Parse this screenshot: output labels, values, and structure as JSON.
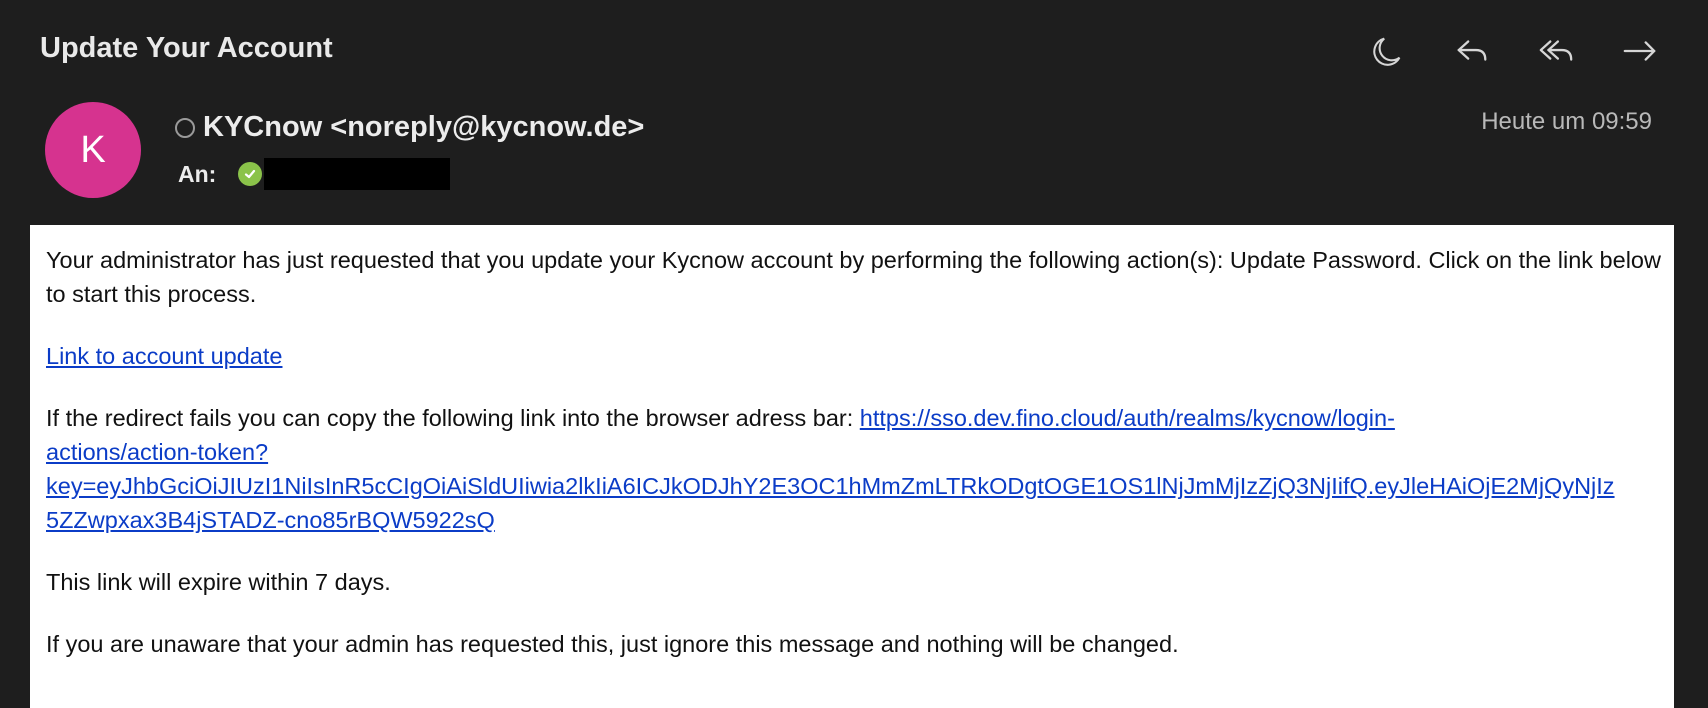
{
  "email": {
    "subject": "Update Your Account",
    "sender": {
      "avatar_initial": "K",
      "avatar_color": "#d6338f",
      "display": "KYCnow <noreply@kycnow.de>"
    },
    "recipient": {
      "label": "An:"
    },
    "timestamp": "Heute um 09:59"
  },
  "toolbar": {
    "icons": [
      "moon-icon",
      "reply-icon",
      "reply-all-icon",
      "forward-icon"
    ]
  },
  "body": {
    "para1": "Your administrator has just requested that you update your Kycnow account by performing the following action(s): Update Password. Click on the link below to start this process.",
    "link_text": "Link to account update",
    "para3_prefix": "If the redirect fails you can copy the following link into the browser adress bar: ",
    "url_line1": "https://sso.dev.fino.cloud/auth/realms/kycnow/login-",
    "url_line2": "actions/action-token?",
    "url_line3": "key=eyJhbGciOiJIUzI1NiIsInR5cCIgOiAiSldUIiwia2lkIiA6ICJkODJhY2E3OC1hMmZmLTRkODgtOGE1OS1lNjJmMjIzZjQ3NjIifQ.eyJleHAiOjE2MjQyNjIz",
    "url_line4": "5ZZwpxax3B4jSTADZ-cno85rBQW5922sQ",
    "para4": "This link will expire within 7 days.",
    "para5": "If you are unaware that your admin has requested this, just ignore this message and nothing will be changed."
  },
  "colors": {
    "background": "#1e1e1e",
    "link": "#0b3cc7",
    "verified": "#8bc34a"
  }
}
